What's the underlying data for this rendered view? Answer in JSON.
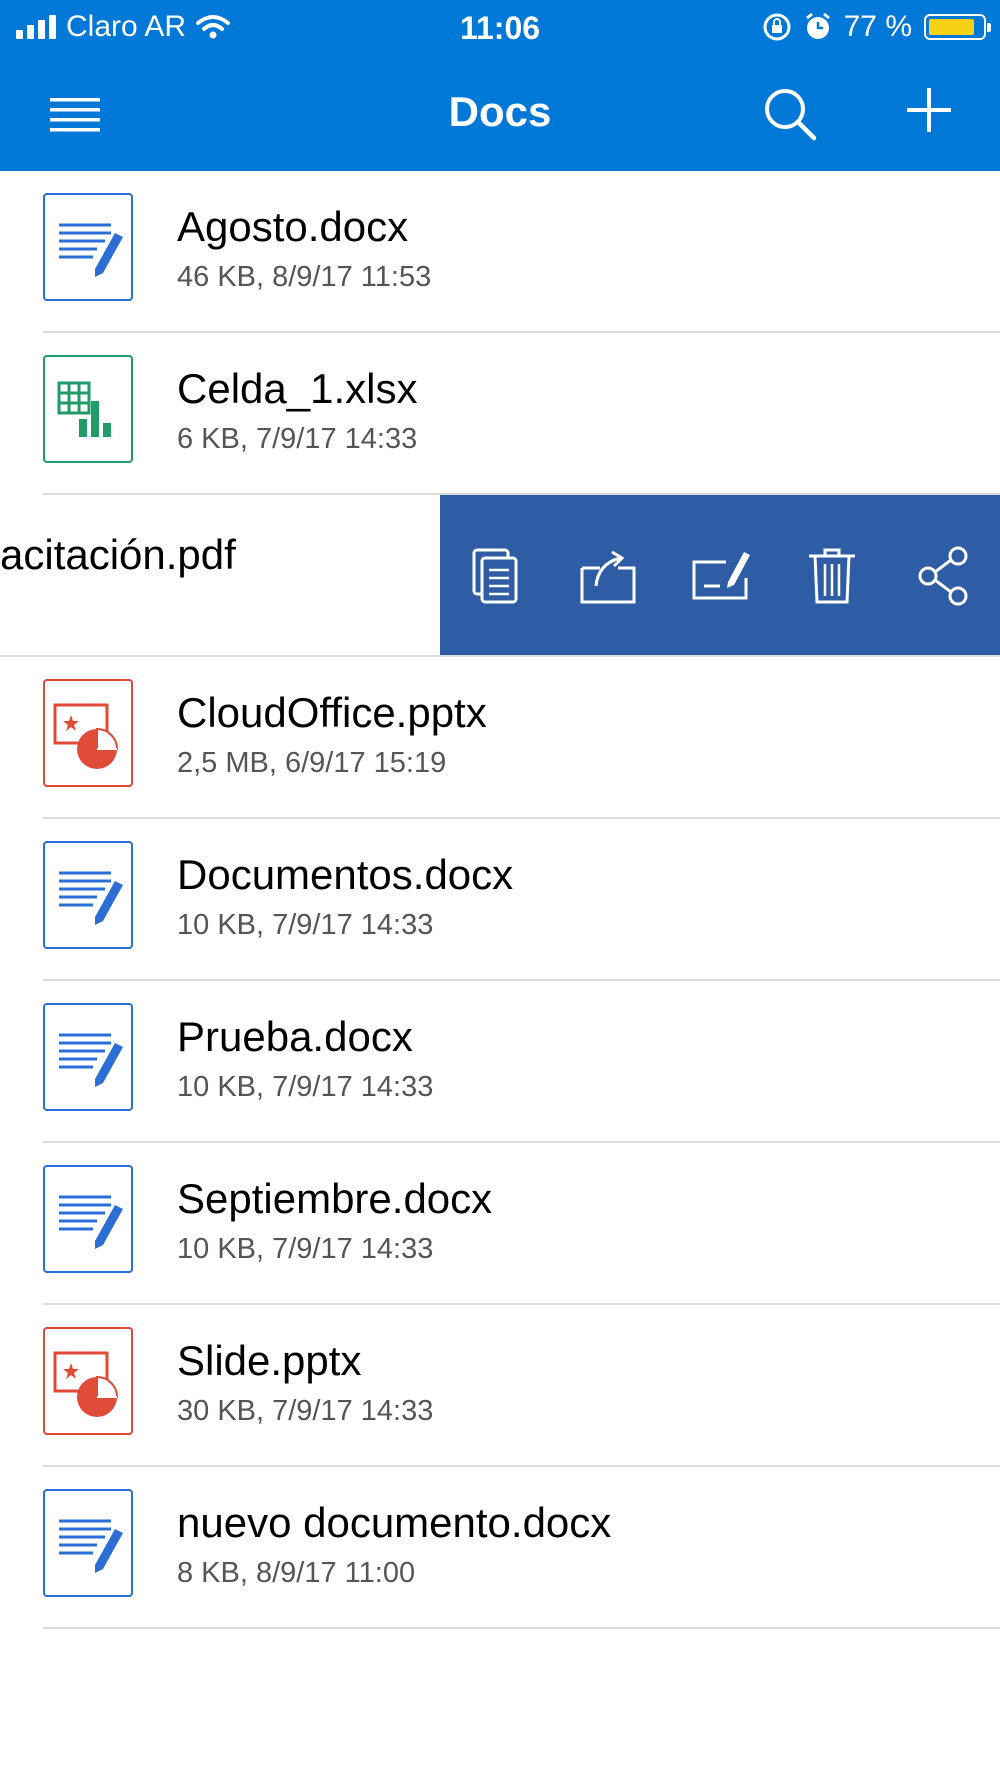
{
  "status_bar": {
    "carrier": "Claro AR",
    "time": "11:06",
    "battery_percent": "77 %",
    "battery_level": 0.77,
    "icons": [
      "signal-icon",
      "wifi-icon",
      "rotation-lock-icon",
      "alarm-icon",
      "battery-icon"
    ]
  },
  "nav": {
    "title": "Docs",
    "icons": [
      "menu-icon",
      "search-icon",
      "add-icon"
    ]
  },
  "colors": {
    "header": "#0078d7",
    "swipe_actions": "#2e5da5",
    "word": "#2b6fd6",
    "excel": "#219b68",
    "powerpoint": "#e04b37"
  },
  "files": [
    {
      "name": "Agosto.docx",
      "meta": "46 KB, 8/9/17 11:53",
      "type": "word"
    },
    {
      "name": "Celda_1.xlsx",
      "meta": "6 KB, 7/9/17 14:33",
      "type": "excel"
    },
    {
      "name": "acitación.pdf",
      "meta": "",
      "type": "pdf"
    },
    {
      "name": "CloudOffice.pptx",
      "meta": "2,5 MB, 6/9/17 15:19",
      "type": "powerpoint"
    },
    {
      "name": "Documentos.docx",
      "meta": "10 KB, 7/9/17 14:33",
      "type": "word"
    },
    {
      "name": "Prueba.docx",
      "meta": "10 KB, 7/9/17 14:33",
      "type": "word"
    },
    {
      "name": "Septiembre.docx",
      "meta": "10 KB, 7/9/17 14:33",
      "type": "word"
    },
    {
      "name": "Slide.pptx",
      "meta": "30 KB, 7/9/17 14:33",
      "type": "powerpoint"
    },
    {
      "name": "nuevo documento.docx",
      "meta": "8 KB, 8/9/17 11:00",
      "type": "word"
    }
  ],
  "swipe_actions": [
    "copy-icon",
    "move-icon",
    "rename-icon",
    "delete-icon",
    "share-icon"
  ]
}
